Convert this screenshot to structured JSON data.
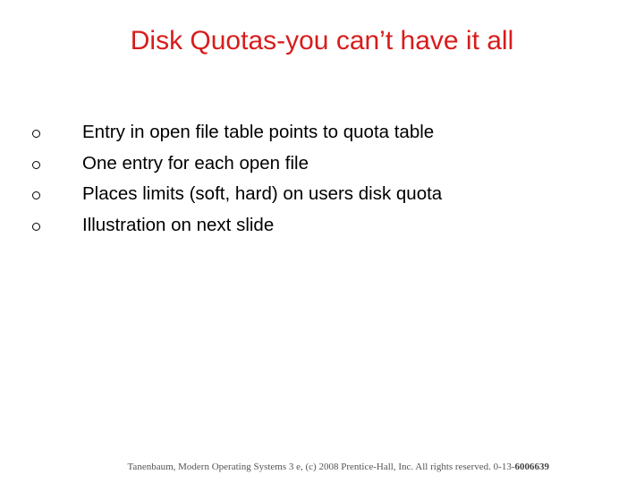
{
  "slide": {
    "title": "Disk Quotas-you can’t have it all",
    "title_color": "#d81c1c",
    "bullet_icon": "hollow-circle",
    "bullets": [
      "Entry in open file table points to quota table",
      "One entry for each open file",
      "Places limits (soft, hard) on users disk quota",
      "Illustration on next slide"
    ],
    "footer": {
      "text": "Tanenbaum, Modern Operating Systems 3 e, (c) 2008 Prentice-Hall, Inc. All rights reserved. 0-13-",
      "isbn_bold": "6006639"
    }
  }
}
